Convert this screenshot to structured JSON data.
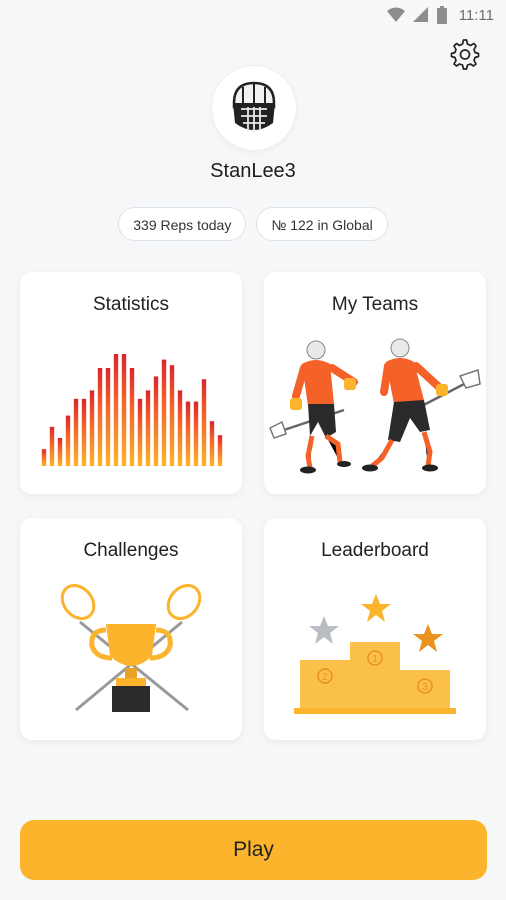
{
  "status": {
    "time": "11:11",
    "icons": [
      "wifi-icon",
      "signal-icon",
      "battery-icon"
    ]
  },
  "settings": {
    "icon": "gear-icon"
  },
  "profile": {
    "avatar_icon": "lacrosse-helmet-icon",
    "username": "StanLee3"
  },
  "stats_pills": {
    "reps": "339 Reps today",
    "rank": "№ 122 in Global"
  },
  "cards": [
    {
      "title": "Statistics",
      "illustration": "bar-chart"
    },
    {
      "title": "My Teams",
      "illustration": "lacrosse-players"
    },
    {
      "title": "Challenges",
      "illustration": "trophy-with-sticks"
    },
    {
      "title": "Leaderboard",
      "illustration": "podium-with-stars",
      "podium_numbers": [
        "1",
        "2",
        "3"
      ]
    }
  ],
  "statistics_chart": {
    "values": [
      6,
      14,
      10,
      18,
      24,
      24,
      27,
      35,
      35,
      40,
      40,
      35,
      24,
      27,
      32,
      38,
      36,
      27,
      23,
      23,
      31,
      16,
      11
    ]
  },
  "play_button": {
    "label": "Play"
  },
  "colors": {
    "accent": "#fbb42c",
    "orange": "#f4622a",
    "red": "#d9262c",
    "background": "#f6f7f9"
  }
}
